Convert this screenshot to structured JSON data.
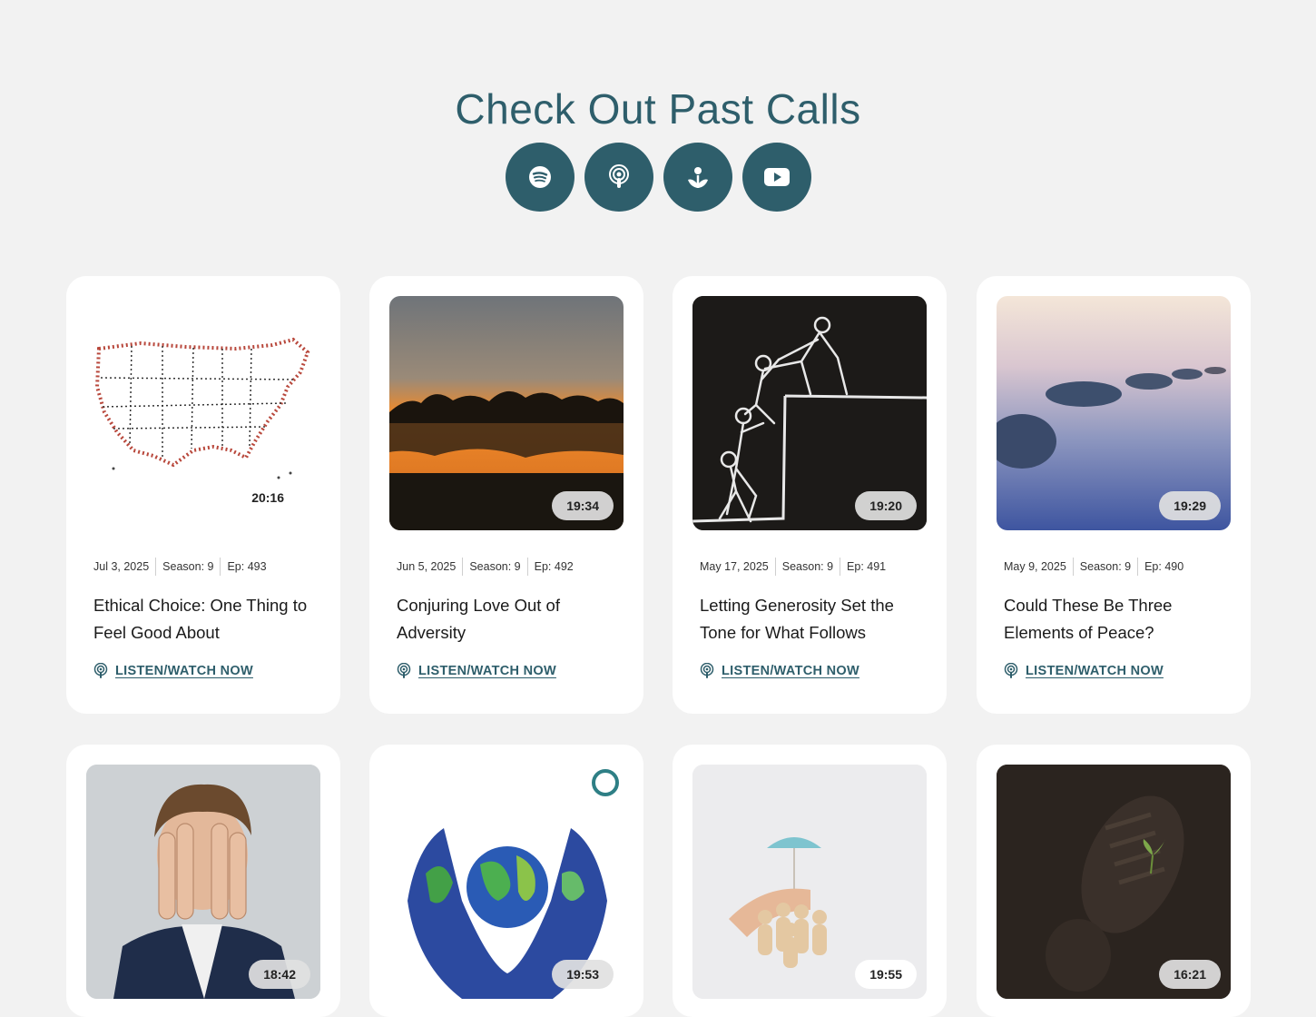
{
  "section": {
    "title": "Check Out Past Calls"
  },
  "platforms": [
    {
      "icon": "spotify-icon"
    },
    {
      "icon": "apple-podcasts-icon"
    },
    {
      "icon": "podcast-app-icon"
    },
    {
      "icon": "youtube-icon"
    }
  ],
  "colors": {
    "accent": "#2e5e6b",
    "page_bg": "#f2f2f2",
    "card_bg": "#ffffff"
  },
  "episodes": [
    {
      "duration": "20:16",
      "date": "Jul 3, 2025",
      "season": "Season: 9",
      "ep": "Ep: 493",
      "title": "Ethical Choice: One Thing to Feel Good About",
      "cta": "LISTEN/WATCH NOW"
    },
    {
      "duration": "19:34",
      "date": "Jun 5, 2025",
      "season": "Season: 9",
      "ep": "Ep: 492",
      "title": "Conjuring Love Out of Adversity",
      "cta": "LISTEN/WATCH NOW"
    },
    {
      "duration": "19:20",
      "date": "May 17, 2025",
      "season": "Season: 9",
      "ep": "Ep: 491",
      "title": "Letting Generosity Set the Tone for What Follows",
      "cta": "LISTEN/WATCH NOW"
    },
    {
      "duration": "19:29",
      "date": "May 9, 2025",
      "season": "Season: 9",
      "ep": "Ep: 490",
      "title": "Could These Be Three Elements of Peace?",
      "cta": "LISTEN/WATCH NOW"
    },
    {
      "duration": "18:42"
    },
    {
      "duration": "19:53"
    },
    {
      "duration": "19:55"
    },
    {
      "duration": "16:21"
    }
  ]
}
